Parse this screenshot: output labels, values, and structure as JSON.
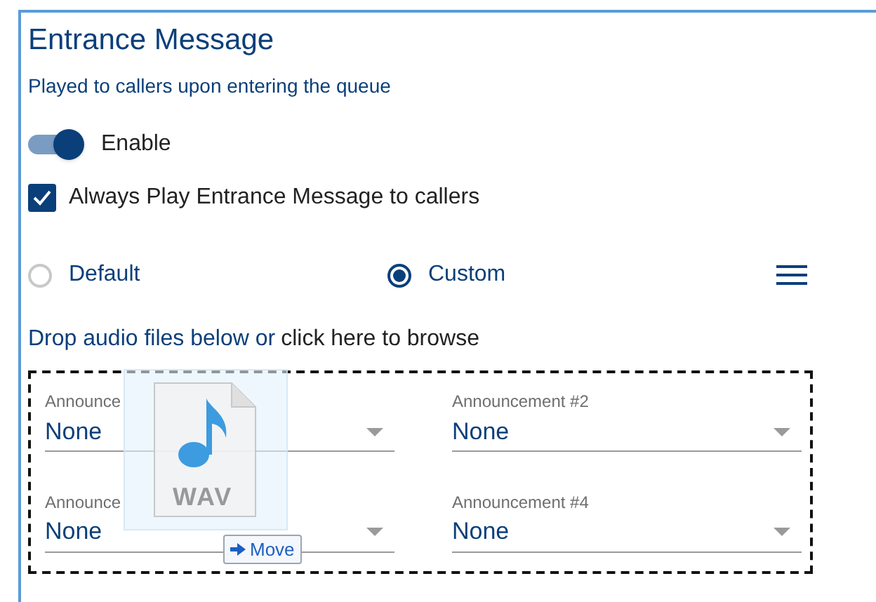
{
  "title": "Entrance Message",
  "subtitle": "Played to callers upon entering the queue",
  "enable": {
    "label": "Enable",
    "on": true
  },
  "always_play": {
    "label": "Always Play Entrance Message to callers",
    "checked": true
  },
  "sources": [
    {
      "label": "Default",
      "selected": false
    },
    {
      "label": "Custom",
      "selected": true
    }
  ],
  "drop_hint": {
    "text": "Drop audio files below or",
    "link": "click here to browse"
  },
  "announcements": [
    {
      "label": "Announce",
      "value": "None"
    },
    {
      "label": "Announcement #2",
      "value": "None"
    },
    {
      "label": "Announce",
      "value": "None"
    },
    {
      "label": "Announcement #4",
      "value": "None"
    }
  ],
  "drag_ghost": {
    "file_type": "WAV",
    "action": "Move"
  }
}
